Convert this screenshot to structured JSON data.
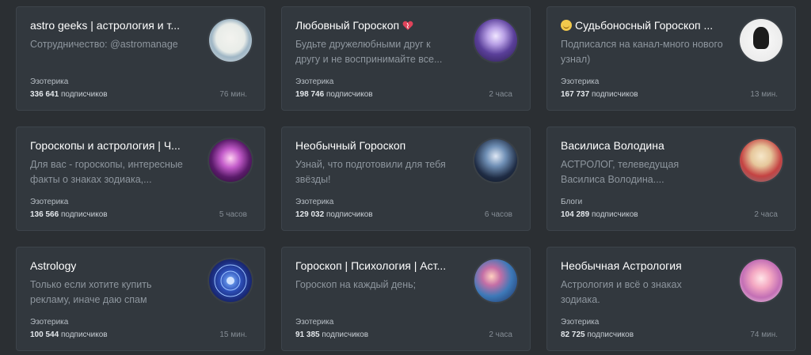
{
  "cards": [
    {
      "title": "astro geeks | астрология и т...",
      "description": "Сотрудничество: @astromanage",
      "category": "Эзотерика",
      "subscribers": "336 641",
      "subscribers_label": "подписчиков",
      "time": "76 мин.",
      "avatar_icon": "astro-geeks-avatar"
    },
    {
      "title": "Любовный Гороскоп",
      "title_suffix_icon": "heart-icon",
      "description": "Будьте дружелюбными друг к другу и не воспринимайте все...",
      "category": "Эзотерика",
      "subscribers": "198 746",
      "subscribers_label": "подписчиков",
      "time": "2 часа",
      "avatar_icon": "love-horoscope-avatar"
    },
    {
      "title": "Судьбоносный Гороскоп ...",
      "title_prefix_icon": "smiling-face-icon",
      "description": "Подписался на канал-много нового узнал)",
      "category": "Эзотерика",
      "subscribers": "167 737",
      "subscribers_label": "подписчиков",
      "time": "13 мин.",
      "avatar_icon": "fateful-horoscope-avatar"
    },
    {
      "title": "Гороскопы и астрология | Ч...",
      "description": "Для вас - гороскопы, интересные факты о знаках зодиака,...",
      "category": "Эзотерика",
      "subscribers": "136 566",
      "subscribers_label": "подписчиков",
      "time": "5 часов",
      "avatar_icon": "horoscopes-astrology-avatar"
    },
    {
      "title": "Необычный Гороскоп",
      "description": "Узнай, что подготовили для тебя звёзды!",
      "category": "Эзотерика",
      "subscribers": "129 032",
      "subscribers_label": "подписчиков",
      "time": "6 часов",
      "avatar_icon": "unusual-horoscope-avatar"
    },
    {
      "title": "Василиса Володина",
      "description": "АСТРОЛОГ, телеведущая Василиса Володина....",
      "category": "Блоги",
      "subscribers": "104 289",
      "subscribers_label": "подписчиков",
      "time": "2 часа",
      "avatar_icon": "vasilisa-volodina-avatar"
    },
    {
      "title": "Astrology",
      "description": "Только если хотите купить рекламу, иначе даю спам",
      "category": "Эзотерика",
      "subscribers": "100 544",
      "subscribers_label": "подписчиков",
      "time": "15 мин.",
      "avatar_icon": "astrology-zodiac-wheel-avatar"
    },
    {
      "title": "Гороскоп | Психология | Аст...",
      "description": "Гороскоп на каждый день;",
      "category": "Эзотерика",
      "subscribers": "91 385",
      "subscribers_label": "подписчиков",
      "time": "2 часа",
      "avatar_icon": "horoscope-psychology-avatar"
    },
    {
      "title": "Необычная Астрология",
      "description": "Астрология и всё о знаках зодиака.",
      "category": "Эзотерика",
      "subscribers": "82 725",
      "subscribers_label": "подписчиков",
      "time": "74 мин.",
      "avatar_icon": "unusual-astrology-avatar"
    }
  ]
}
